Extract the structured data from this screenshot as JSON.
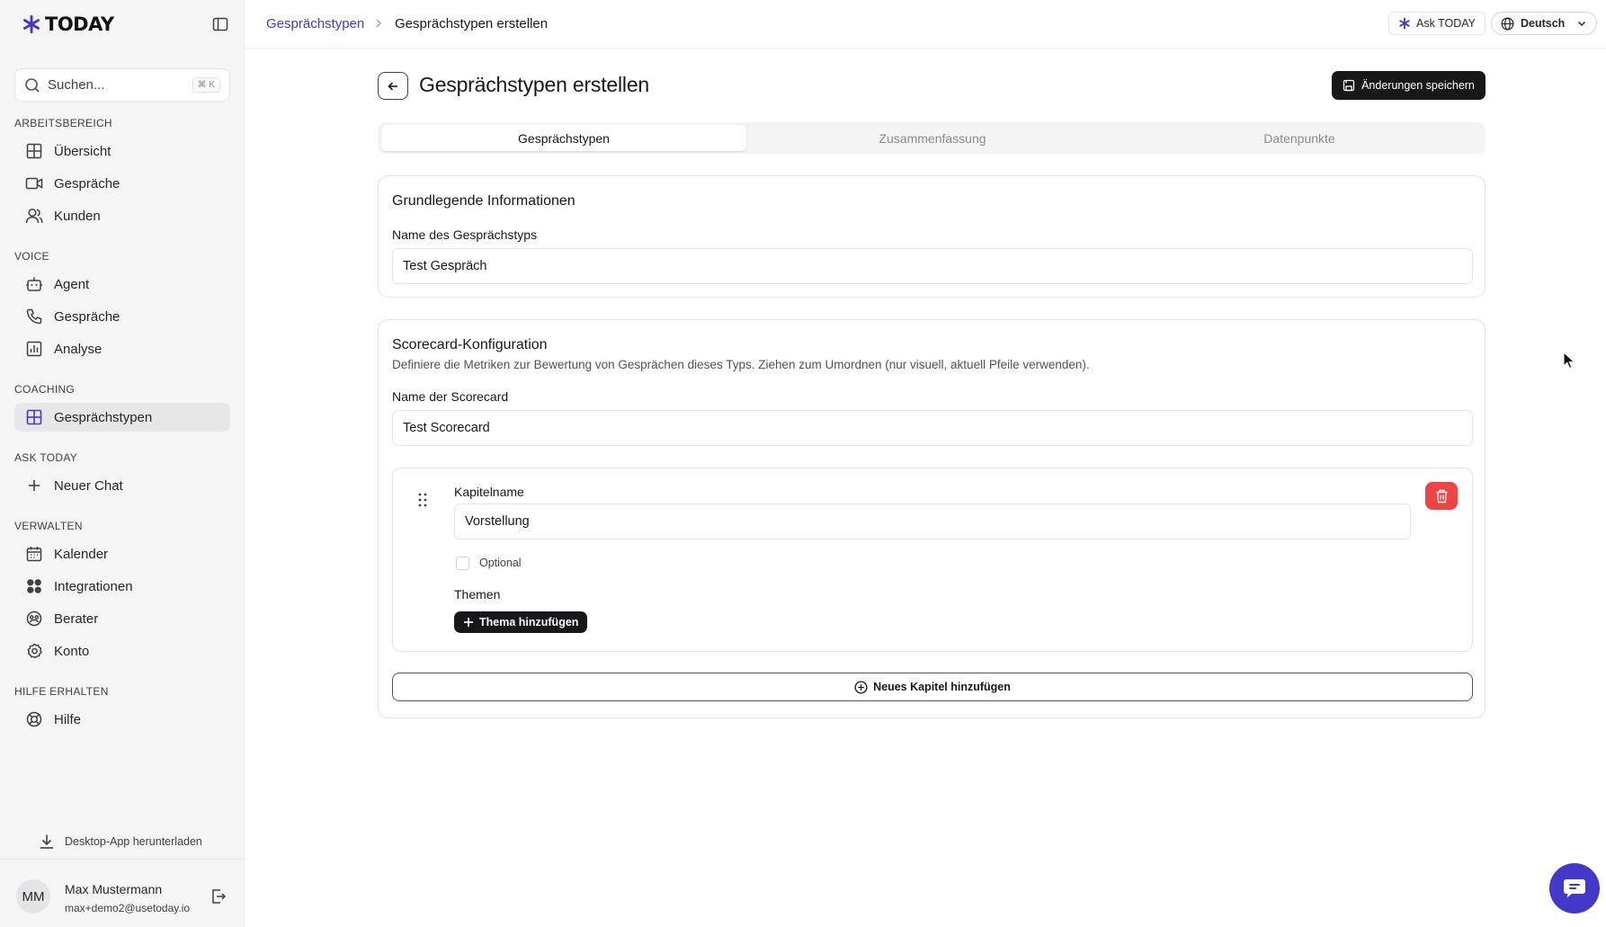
{
  "brand": {
    "name": "TODAY",
    "accent": "#4338ca"
  },
  "search": {
    "placeholder": "Suchen...",
    "shortcut": "⌘ K"
  },
  "sidebar": {
    "sections": [
      {
        "title": "ARBEITSBEREICH",
        "items": [
          {
            "label": "Übersicht",
            "icon": "grid-icon"
          },
          {
            "label": "Gespräche",
            "icon": "video-icon"
          },
          {
            "label": "Kunden",
            "icon": "users-icon"
          }
        ]
      },
      {
        "title": "VOICE",
        "items": [
          {
            "label": "Agent",
            "icon": "bot-icon"
          },
          {
            "label": "Gespräche",
            "icon": "phone-icon"
          },
          {
            "label": "Analyse",
            "icon": "chart-icon"
          }
        ]
      },
      {
        "title": "COACHING",
        "items": [
          {
            "label": "Gesprächstypen",
            "icon": "grid-icon",
            "active": true
          }
        ]
      },
      {
        "title": "ASK TODAY",
        "items": [
          {
            "label": "Neuer Chat",
            "icon": "plus-icon"
          }
        ]
      },
      {
        "title": "VERWALTEN",
        "items": [
          {
            "label": "Kalender",
            "icon": "calendar-icon"
          },
          {
            "label": "Integrationen",
            "icon": "integrations-icon"
          },
          {
            "label": "Berater",
            "icon": "advisor-icon"
          },
          {
            "label": "Konto",
            "icon": "settings-icon"
          }
        ]
      },
      {
        "title": "HILFE ERHALTEN",
        "items": [
          {
            "label": "Hilfe",
            "icon": "lifebuoy-icon"
          }
        ]
      }
    ],
    "download": "Desktop-App herunterladen",
    "user": {
      "initials": "MM",
      "name": "Max Mustermann",
      "email": "max+demo2@usetoday.io"
    }
  },
  "topbar": {
    "breadcrumb_parent": "Gesprächstypen",
    "breadcrumb_current": "Gesprächstypen erstellen",
    "ask_label": "Ask TODAY",
    "language": "Deutsch"
  },
  "page": {
    "title": "Gesprächstypen erstellen",
    "save_label": "Änderungen speichern",
    "tabs": [
      "Gesprächstypen",
      "Zusammenfassung",
      "Datenpunkte"
    ],
    "active_tab": 0
  },
  "basic_info": {
    "title": "Grundlegende Informationen",
    "name_label": "Name des Gesprächstyps",
    "name_value": "Test Gespräch"
  },
  "scorecard": {
    "title": "Scorecard-Konfiguration",
    "description": "Definiere die Metriken zur Bewertung von Gesprächen dieses Typs. Ziehen zum Umordnen (nur visuell, aktuell Pfeile verwenden).",
    "name_label": "Name der Scorecard",
    "name_value": "Test Scorecard",
    "chapter": {
      "name_label": "Kapitelname",
      "name_value": "Vorstellung",
      "optional_label": "Optional",
      "optional_checked": false,
      "topics_label": "Themen",
      "add_topic_label": "Thema hinzufügen"
    },
    "add_chapter_label": "Neues Kapitel hinzufügen"
  }
}
